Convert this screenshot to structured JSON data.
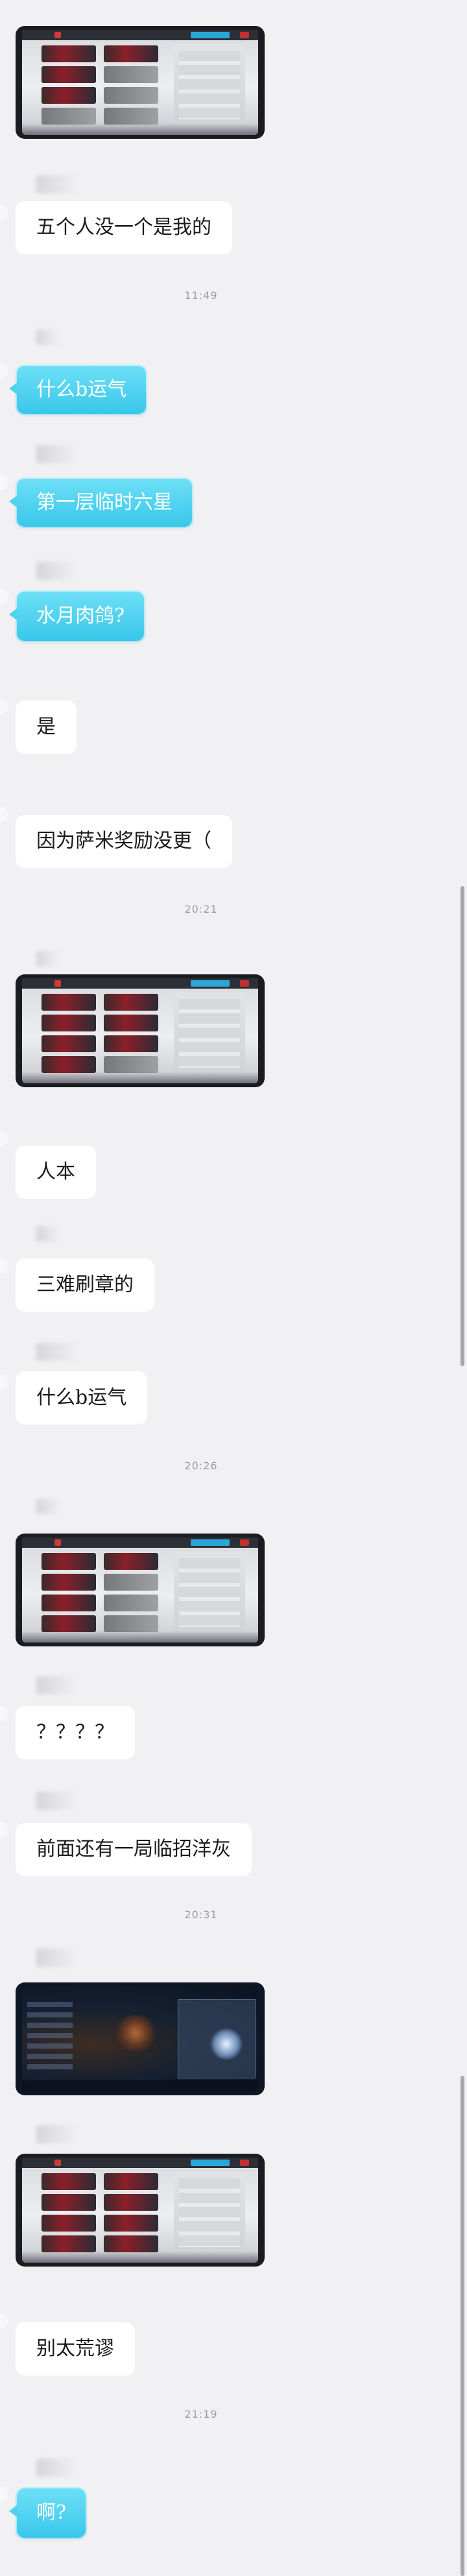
{
  "colors": {
    "background": "#f1f1f3",
    "bubble_white": "#ffffff",
    "bubble_blue": "#4fd1f0",
    "timestamp": "#9b9b9f",
    "scrollbar": "#a8a8ab"
  },
  "messages": [
    {
      "type": "image",
      "content": "game-screenshot-team"
    },
    {
      "type": "text",
      "style": "white",
      "text": "五个人没一个是我的"
    },
    {
      "type": "time",
      "text": "11:49"
    },
    {
      "type": "text",
      "style": "blue",
      "text": "什么b运气"
    },
    {
      "type": "text",
      "style": "blue",
      "text": "第一层临时六星"
    },
    {
      "type": "text",
      "style": "blue",
      "text": "水月肉鸽?"
    },
    {
      "type": "text",
      "style": "white",
      "text": "是"
    },
    {
      "type": "text",
      "style": "white",
      "text": "因为萨米奖励没更（"
    },
    {
      "type": "time",
      "text": "20:21"
    },
    {
      "type": "image",
      "content": "game-screenshot-team"
    },
    {
      "type": "text",
      "style": "white",
      "text": "人本"
    },
    {
      "type": "text",
      "style": "white",
      "text": "三难刷章的"
    },
    {
      "type": "text",
      "style": "white",
      "text": "什么b运气"
    },
    {
      "type": "time",
      "text": "20:26"
    },
    {
      "type": "image",
      "content": "game-screenshot-team"
    },
    {
      "type": "text",
      "style": "white",
      "text": "？？？？"
    },
    {
      "type": "text",
      "style": "white",
      "text": "前面还有一局临招洋灰"
    },
    {
      "type": "time",
      "text": "20:31"
    },
    {
      "type": "image",
      "content": "game-screenshot-map"
    },
    {
      "type": "image",
      "content": "game-screenshot-team"
    },
    {
      "type": "text",
      "style": "white",
      "text": "别太荒谬"
    },
    {
      "type": "time",
      "text": "21:19"
    },
    {
      "type": "text",
      "style": "blue",
      "text": "啊?"
    }
  ]
}
